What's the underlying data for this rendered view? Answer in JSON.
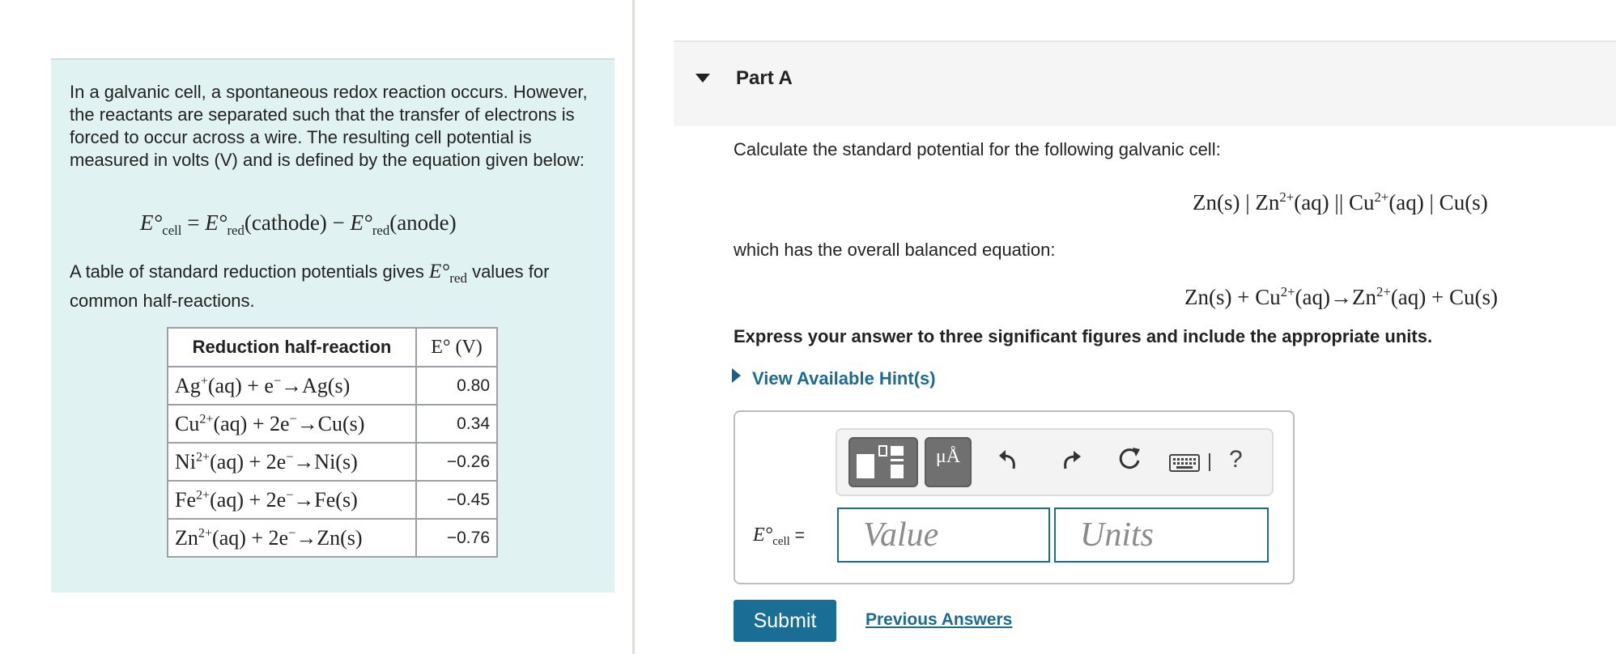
{
  "intro": {
    "paragraph1": "In a galvanic cell, a spontaneous redox reaction occurs. However, the reactants are separated such that the transfer of electrons is forced to occur across a wire. The resulting cell potential is measured in volts (V) and is defined by the equation given below:",
    "equation": {
      "lhs": "E°",
      "lhs_sub": "cell",
      "eq": " = ",
      "e1": "E°",
      "e1_sub": "red",
      "e1_arg": "(cathode)",
      "minus": " − ",
      "e2": "E°",
      "e2_sub": "red",
      "e2_arg": "(anode)"
    },
    "paragraph2_pre": "A table of standard reduction potentials gives ",
    "paragraph2_sym": "E°",
    "paragraph2_sub": "red",
    "paragraph2_post": " values for common half-reactions."
  },
  "table": {
    "header_reaction": "Reduction half-reaction",
    "header_value": "E° (V)",
    "rows": [
      {
        "a": "Ag",
        "a_sup": "+",
        "mid": "(aq) + e",
        "e_sup": "−",
        "rest": "→Ag(s)",
        "value": "0.80"
      },
      {
        "a": "Cu",
        "a_sup": "2+",
        "mid": "(aq) + 2e",
        "e_sup": "−",
        "rest": "→Cu(s)",
        "value": "0.34"
      },
      {
        "a": "Ni",
        "a_sup": "2+",
        "mid": "(aq) + 2e",
        "e_sup": "−",
        "rest": "→Ni(s)",
        "value": "−0.26"
      },
      {
        "a": "Fe",
        "a_sup": "2+",
        "mid": "(aq) + 2e",
        "e_sup": "−",
        "rest": "→Fe(s)",
        "value": "−0.45"
      },
      {
        "a": "Zn",
        "a_sup": "2+",
        "mid": "(aq) + 2e",
        "e_sup": "−",
        "rest": "→Zn(s)",
        "value": "−0.76"
      }
    ]
  },
  "part": {
    "title": "Part A",
    "question": "Calculate the standard potential for the following galvanic cell:",
    "cell": {
      "p1": "Zn(s) | Zn",
      "s1": "2+",
      "p2": "(aq) || Cu",
      "s2": "2+",
      "p3": "(aq) | Cu(s)"
    },
    "between": "which has the overall balanced equation:",
    "overall": {
      "p1": "Zn(s) + Cu",
      "s1": "2+",
      "p2": "(aq)→Zn",
      "s2": "2+",
      "p3": "(aq) + Cu(s)"
    },
    "instruction": "Express your answer to three significant figures and include the appropriate units.",
    "hint_label": "View Available Hint(s)"
  },
  "answer": {
    "label": "E°",
    "label_sub": "cell",
    "label_eq": " =",
    "mu_label": "μÅ",
    "help_label": "?",
    "value_placeholder": "Value",
    "units_placeholder": "Units"
  },
  "actions": {
    "submit_label": "Submit",
    "previous_label": "Previous Answers"
  },
  "colors": {
    "intro_bg": "#e0f3f2",
    "accent": "#1b6b93",
    "submit_bg": "#1a6e96"
  }
}
